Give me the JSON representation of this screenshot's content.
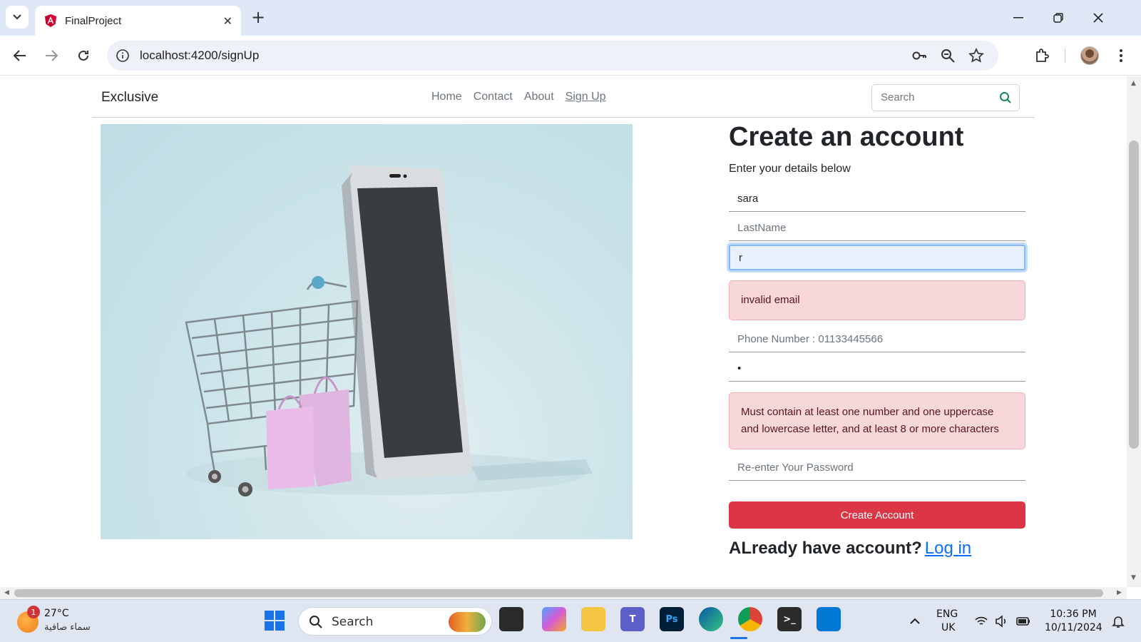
{
  "browser": {
    "tab_title": "FinalProject",
    "url": "localhost:4200/signUp"
  },
  "site": {
    "brand": "Exclusive",
    "nav": [
      {
        "label": "Home",
        "active": false
      },
      {
        "label": "Contact",
        "active": false
      },
      {
        "label": "About",
        "active": false
      },
      {
        "label": "Sign Up",
        "active": true
      }
    ],
    "search_placeholder": "Search"
  },
  "form": {
    "title": "Create an account",
    "subtitle": "Enter your details below",
    "first_name_value": "sara",
    "last_name_placeholder": "LastName",
    "email_value": "r",
    "email_error": "invalid email",
    "phone_placeholder": "Phone Number : 01133445566",
    "password_value": "•",
    "password_error": "Must contain at least one number and one uppercase and lowercase letter, and at least 8 or more characters",
    "repassword_placeholder": "Re-enter Your Password",
    "submit_label": "Create Account",
    "login_prompt": "ALready have account?",
    "login_link": "Log in"
  },
  "taskbar": {
    "weather_temp": "27°C",
    "weather_desc": "سماء صافية",
    "weather_badge": "1",
    "search_label": "Search",
    "lang_top": "ENG",
    "lang_bottom": "UK",
    "time": "10:36 PM",
    "date": "10/11/2024"
  },
  "colors": {
    "primary_button": "#dc3545",
    "alert_bg": "#f8d7da",
    "link": "#0d6efd"
  }
}
